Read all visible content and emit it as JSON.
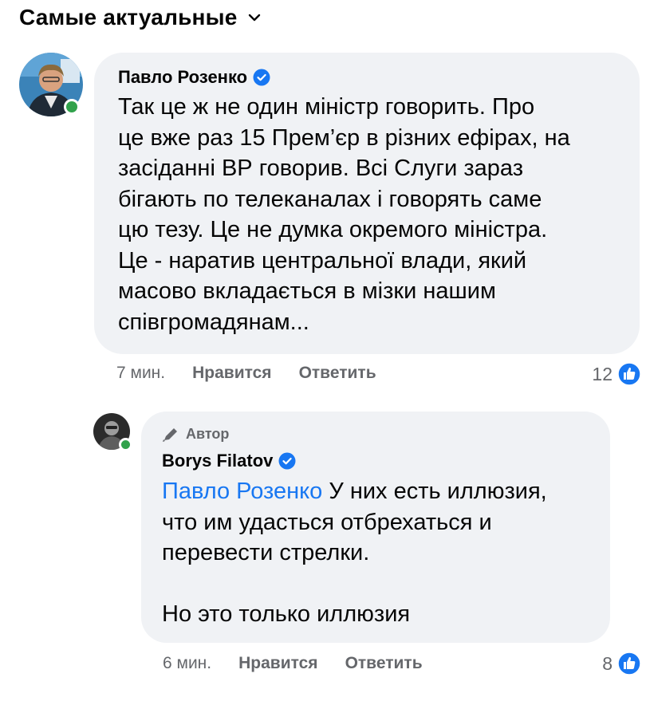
{
  "sort": {
    "label": "Самые актуальные"
  },
  "comments": [
    {
      "author": "Павло Розенко",
      "verified": true,
      "text_lines": [
        "Так це ж не один міністр говорить. Про",
        "це вже раз 15 Прем’єр в різних ефірах, на",
        "засіданні ВР говорив. Всі Слуги зараз",
        "бігають по телеканалах і говорять саме",
        "цю тезу. Це не думка окремого міністра.",
        "Це - наратив центральної влади, який",
        "масово вкладається в мізки нашим",
        "співгромадянам..."
      ],
      "time": "7 мин.",
      "like_label": "Нравится",
      "reply_label": "Ответить",
      "likes": "12"
    }
  ],
  "reply": {
    "badge": "Автор",
    "author": "Borys Filatov",
    "verified": true,
    "mention": "Павло Розенко",
    "text_lines": [
      " У них есть иллюзия,",
      "что им удасться отбрехаться и",
      "перевести стрелки.",
      "",
      "Но это только иллюзия"
    ],
    "time": "6 мин.",
    "like_label": "Нравится",
    "reply_label": "Ответить",
    "likes": "8"
  },
  "colors": {
    "accent": "#1877f2",
    "bubble": "#f0f2f5",
    "online": "#31a24c",
    "meta": "#65676b"
  },
  "icons": [
    "chevron-down-icon",
    "verified-badge-icon",
    "like-reaction-icon",
    "pencil-author-icon"
  ]
}
